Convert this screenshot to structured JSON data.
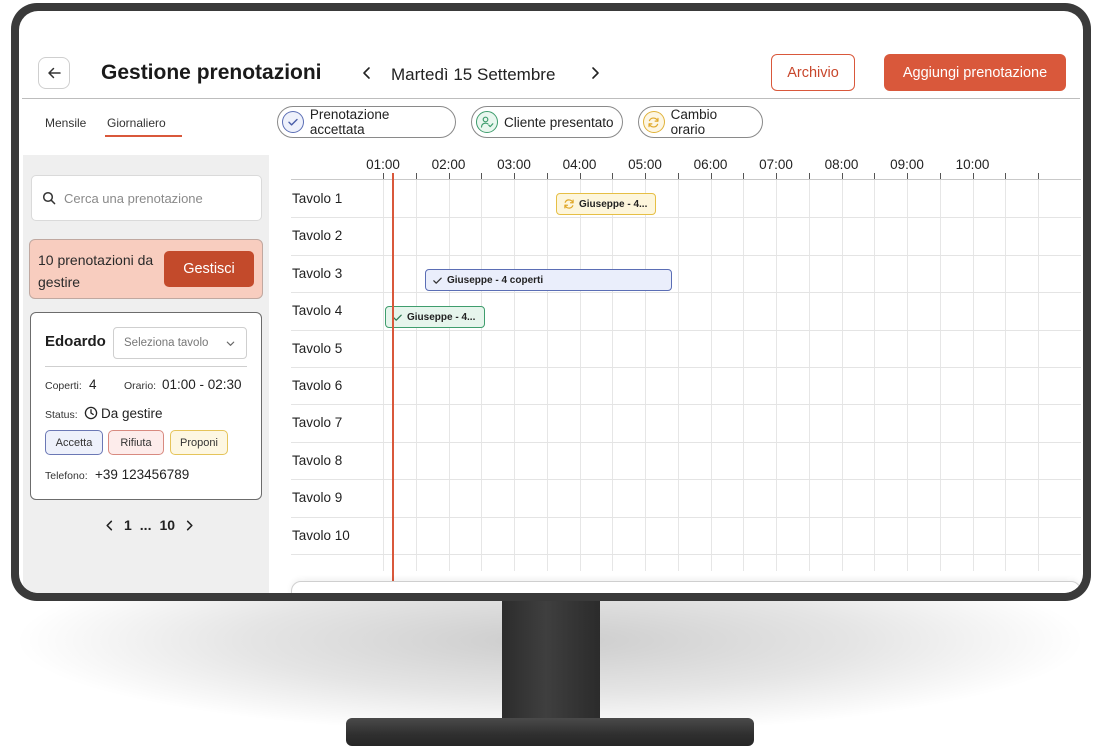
{
  "header": {
    "title": "Gestione prenotazioni",
    "date": "Martedì 15 Settembre",
    "archive_label": "Archivio",
    "add_label": "Aggiungi prenotazione"
  },
  "view_tabs": {
    "monthly": "Mensile",
    "daily": "Giornaliero",
    "active": "Giornaliero"
  },
  "legend": {
    "accepted": "Prenotazione accettata",
    "present": "Cliente presentato",
    "time_change": "Cambio orario"
  },
  "sidebar": {
    "search_placeholder": "Cerca una prenotazione",
    "pending_text": "10 prenotazioni da gestire",
    "manage_label": "Gestisci",
    "card": {
      "name": "Edoardo",
      "table_placeholder": "Seleziona tavolo",
      "covers_label": "Coperti:",
      "covers_value": "4",
      "time_label": "Orario:",
      "time_value": "01:00 - 02:30",
      "status_label": "Status:",
      "status_value": "Da gestire",
      "accept_label": "Accetta",
      "reject_label": "Rifiuta",
      "propose_label": "Proponi",
      "phone_label": "Telefono:",
      "phone_value": "+39 123456789"
    },
    "pager": {
      "current": "1",
      "ellipsis": "...",
      "last": "10"
    }
  },
  "timeline": {
    "hours": [
      "01:00",
      "02:00",
      "03:00",
      "04:00",
      "05:00",
      "06:00",
      "07:00",
      "08:00",
      "09:00",
      "10:00"
    ],
    "tables": [
      "Tavolo 1",
      "Tavolo 2",
      "Tavolo 3",
      "Tavolo 4",
      "Tavolo 5",
      "Tavolo 6",
      "Tavolo 7",
      "Tavolo 8",
      "Tavolo 9",
      "Tavolo 10"
    ],
    "bookings": [
      {
        "label": "Giuseppe - 4...",
        "table": "Tavolo 1",
        "status": "time_change"
      },
      {
        "label": "Giuseppe - 4 coperti",
        "table": "Tavolo 3",
        "status": "accepted"
      },
      {
        "label": "Giuseppe - 4...",
        "table": "Tavolo 4",
        "status": "present"
      }
    ]
  },
  "colors": {
    "accent": "#d9583b",
    "accepted": "#5b6eb5",
    "present": "#3f9d6d",
    "time_change": "#e0b23a"
  }
}
